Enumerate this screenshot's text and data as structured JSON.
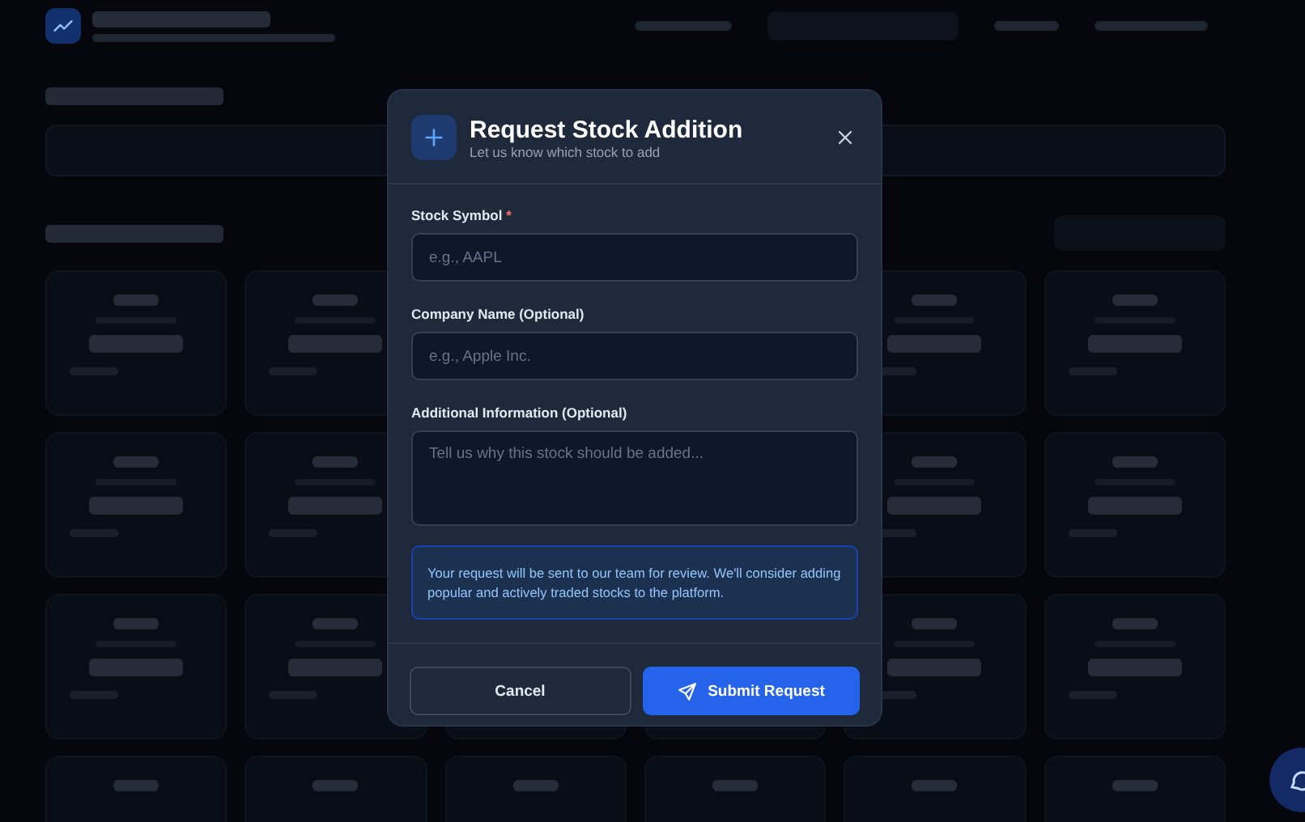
{
  "modal": {
    "title": "Request Stock Addition",
    "subtitle": "Let us know which stock to add",
    "fields": [
      {
        "kind": "input",
        "label": "Stock Symbol",
        "required_mark": "*",
        "placeholder": "e.g., AAPL"
      },
      {
        "kind": "input",
        "label": "Company Name (Optional)",
        "placeholder": "e.g., Apple Inc."
      },
      {
        "kind": "textarea",
        "label": "Additional Information (Optional)",
        "placeholder": "Tell us why this stock should be added..."
      }
    ],
    "note": "Your request will be sent to our team for review. We'll consider adding popular and actively traded stocks to the platform.",
    "buttons": [
      {
        "kind": "secondary",
        "label": "Cancel"
      },
      {
        "kind": "primary",
        "label": "Submit Request"
      }
    ]
  }
}
